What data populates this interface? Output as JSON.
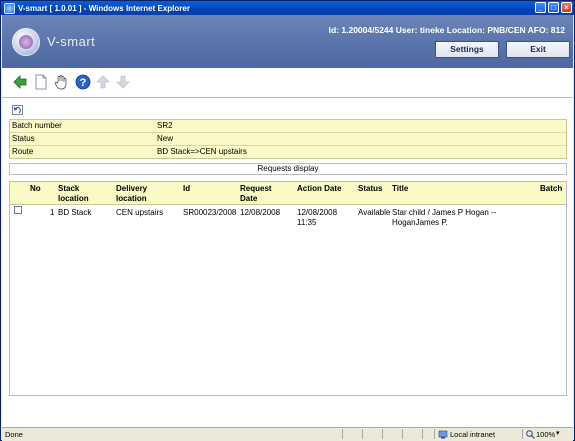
{
  "window": {
    "title": "V-smart [ 1.0.01 ] - Windows Internet Explorer"
  },
  "header": {
    "brand": "V-smart",
    "user_info": "Id: 1.20004/5244   User: tineke   Location: PNB/CEN   AFO: 812",
    "settings_label": "Settings",
    "exit_label": "Exit"
  },
  "info": {
    "rows": [
      {
        "label": "Batch number",
        "value": "SR2"
      },
      {
        "label": "Status",
        "value": "New"
      },
      {
        "label": "Route",
        "value": "BD Stack=>CEN upstairs"
      }
    ]
  },
  "requests": {
    "heading": "Requests display",
    "columns": {
      "no": "No",
      "stack_location": "Stack location",
      "delivery_location": "Delivery location",
      "id": "Id",
      "request_date": "Request Date",
      "action_date": "Action Date",
      "status": "Status",
      "title": "Title",
      "batch": "Batch"
    },
    "rows": [
      {
        "no": "1",
        "stack_location": "BD Stack",
        "delivery_location": "CEN upstairs",
        "id": "SR00023/2008",
        "request_date": "12/08/2008",
        "action_date_line1": "12/08/2008",
        "action_date_line2": "11:35",
        "status": "Available",
        "title_line1": "Star child / James P Hogan --",
        "title_line2": "HoganJames P.",
        "batch": ""
      }
    ]
  },
  "statusbar": {
    "text": "Done",
    "zone": "Local intranet",
    "zoom": "100%"
  },
  "icons": [
    "back-arrow-icon",
    "new-document-icon",
    "hand-select-icon",
    "help-icon",
    "up-arrow-icon",
    "down-arrow-icon",
    "undo-icon"
  ]
}
